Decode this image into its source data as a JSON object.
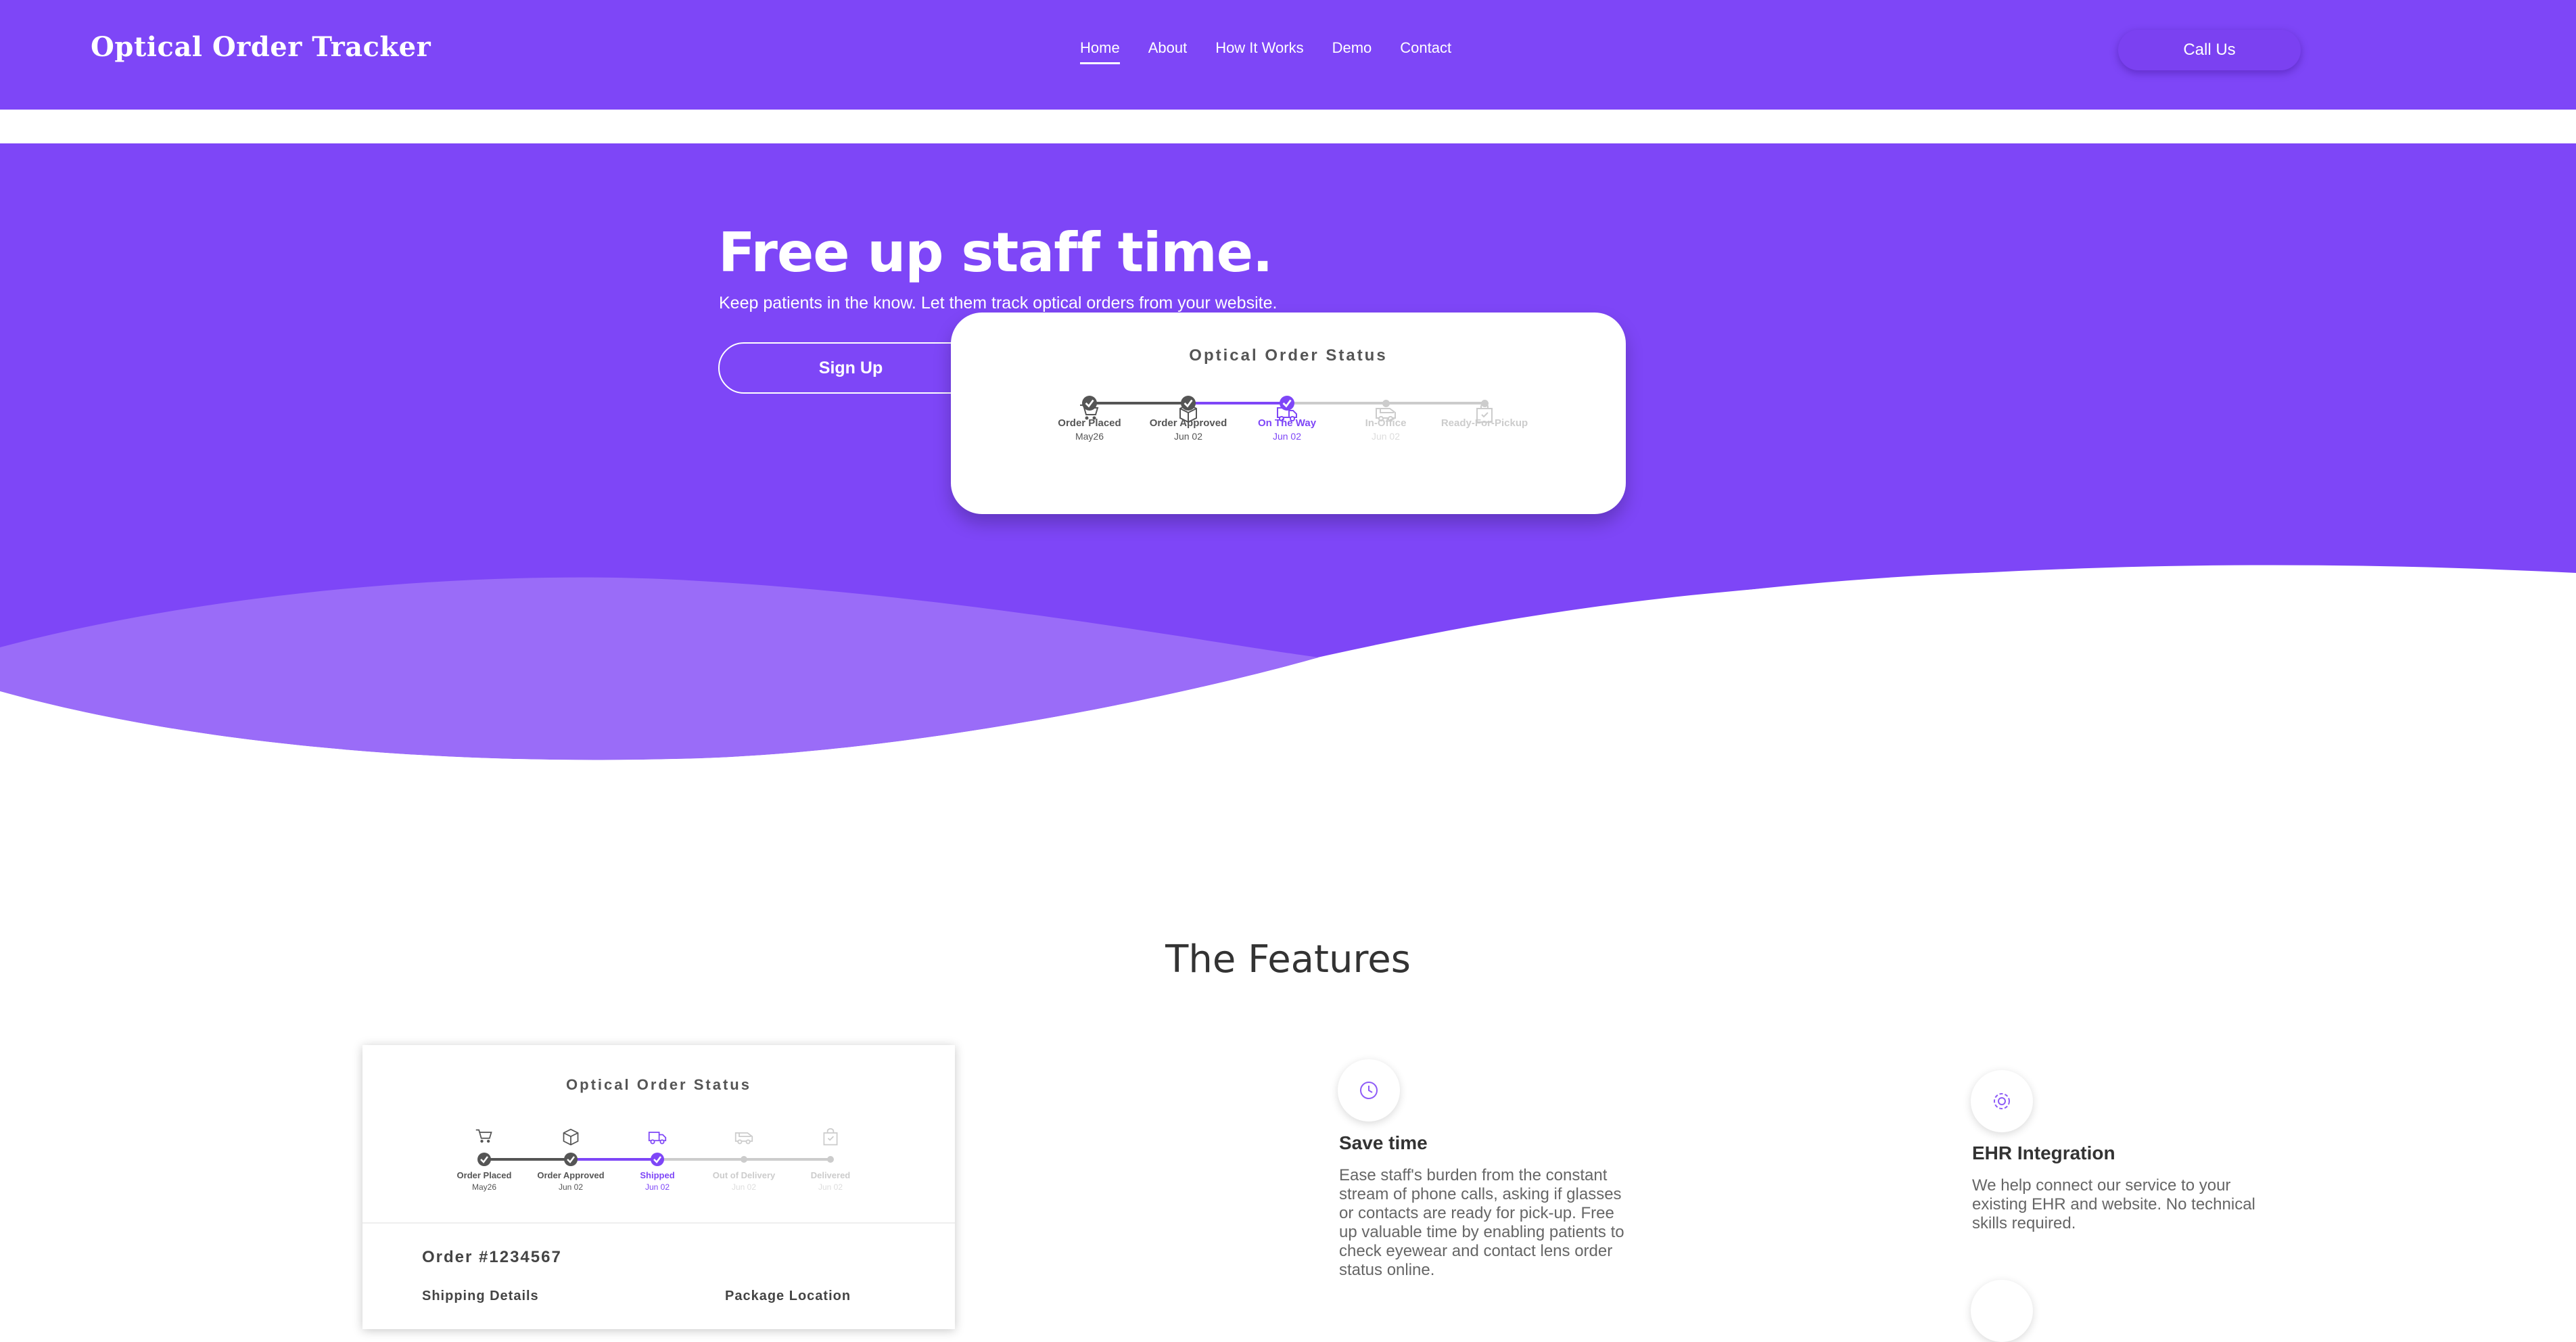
{
  "header": {
    "logo": "Optical Order Tracker",
    "nav": [
      "Home",
      "About",
      "How It Works",
      "Demo",
      "Contact"
    ],
    "active_nav": "Home",
    "call_button": "Call Us"
  },
  "hero": {
    "title": "Free up staff time.",
    "subtitle": "Keep patients in the know. Let them track optical orders from your website.",
    "signup_button": "Sign Up"
  },
  "hero_status": {
    "title": "Optical Order Status",
    "steps": [
      {
        "icon": "cart-icon",
        "label": "Order Placed",
        "date": "May26",
        "state": "done"
      },
      {
        "icon": "box-icon",
        "label": "Order Approved",
        "date": "Jun 02",
        "state": "done"
      },
      {
        "icon": "truck-icon",
        "label": "On The Way",
        "date": "Jun 02",
        "state": "current"
      },
      {
        "icon": "van-icon",
        "label": "In-Office",
        "date": "Jun 02",
        "state": "pending"
      },
      {
        "icon": "bag-icon",
        "label": "Ready-For-Pickup",
        "date": "",
        "state": "pending"
      }
    ]
  },
  "features": {
    "title": "The Features",
    "demo_status": {
      "title": "Optical Order Status",
      "steps": [
        {
          "icon": "cart-icon",
          "label": "Order Placed",
          "date": "May26",
          "state": "done"
        },
        {
          "icon": "box-icon",
          "label": "Order Approved",
          "date": "Jun 02",
          "state": "done"
        },
        {
          "icon": "truck-icon",
          "label": "Shipped",
          "date": "Jun 02",
          "state": "current"
        },
        {
          "icon": "van-icon",
          "label": "Out of Delivery",
          "date": "Jun 02",
          "state": "pending"
        },
        {
          "icon": "bag-icon",
          "label": "Delivered",
          "date": "Jun 02",
          "state": "pending"
        }
      ],
      "order_number": "Order #1234567",
      "shipping_heading": "Shipping Details",
      "package_heading": "Package Location"
    },
    "items": [
      {
        "icon": "clock-icon",
        "title": "Save time",
        "text": "Ease staff's burden from the constant stream of phone calls, asking if glasses or contacts are ready for pick-up. Free up valuable time  by enabling patients to check eyewear and contact lens order status online."
      },
      {
        "icon": "gear-icon",
        "title": "EHR Integration",
        "text": "We help connect our service to your existing EHR and website. No technical skills required."
      }
    ]
  },
  "colors": {
    "brand": "#7e46f7",
    "wave_light": "#9b6bf8",
    "done": "#555555",
    "current": "#7e46f7",
    "pending": "#cccccc"
  }
}
